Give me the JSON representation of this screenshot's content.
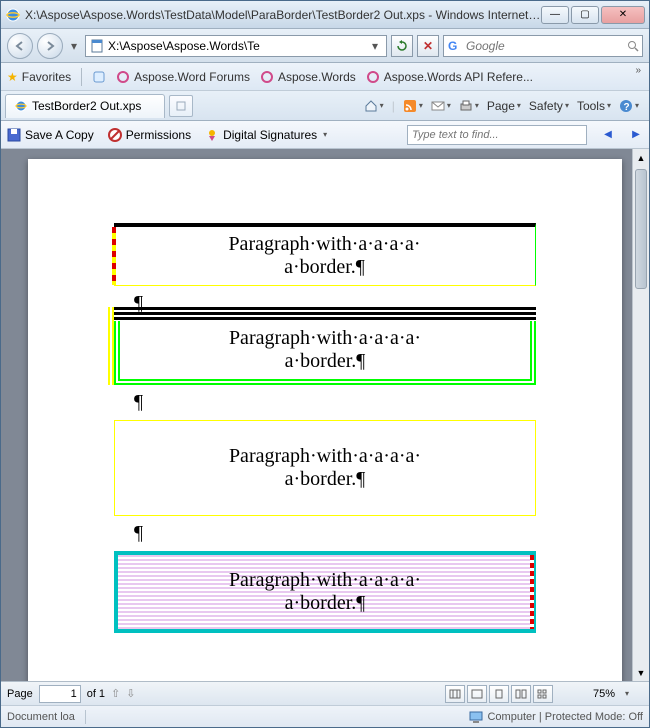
{
  "window": {
    "title": "X:\\Aspose\\Aspose.Words\\TestData\\Model\\ParaBorder\\TestBorder2 Out.xps - Windows Internet ..."
  },
  "navbar": {
    "address": "X:\\Aspose\\Aspose.Words\\Te",
    "search_placeholder": "Google"
  },
  "favbar": {
    "favorites": "Favorites",
    "links": [
      "Aspose.Word Forums",
      "Aspose.Words",
      "Aspose.Words API Refere..."
    ]
  },
  "tab": {
    "label": "TestBorder2 Out.xps"
  },
  "cmdbar": {
    "page": "Page",
    "safety": "Safety",
    "tools": "Tools"
  },
  "xps_toolbar": {
    "save": "Save A Copy",
    "permissions": "Permissions",
    "signatures": "Digital Signatures",
    "find_placeholder": "Type text to find..."
  },
  "document": {
    "para_text": "Paragraph·with·a·a·a·a·",
    "para_text2": "a·border.¶",
    "pilcrow": "¶"
  },
  "bottombar": {
    "page_label": "Page",
    "page_current": "1",
    "page_of": "of 1",
    "zoom": "75%"
  },
  "statusbar": {
    "status": "Document loa",
    "zone": "Computer | Protected Mode: Off"
  }
}
